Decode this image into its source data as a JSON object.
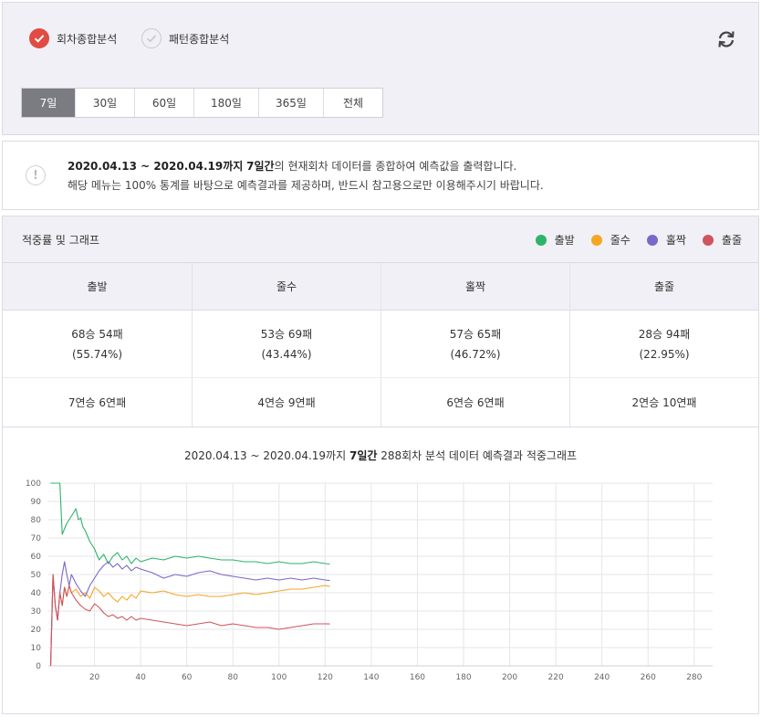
{
  "analysis_type": {
    "options": [
      {
        "label": "회차종합분석",
        "selected": true
      },
      {
        "label": "패턴종합분석",
        "selected": false
      }
    ],
    "refresh_icon": "refresh-icon"
  },
  "periods": {
    "items": [
      "7일",
      "30일",
      "60일",
      "180일",
      "365일",
      "전체"
    ],
    "active": "7일"
  },
  "notice": {
    "icon": "exclamation-icon",
    "range": "2020.04.13 ~ 2020.04.19까지",
    "days": "7일간",
    "line1_rest": "의 현재회차 데이터를 종합하여 예측값을 출력합니다.",
    "line2": "해당 메뉴는 100% 통계를 바탕으로 예측결과를 제공하며, 반드시 참고용으로만 이용해주시기 바랍니다."
  },
  "result": {
    "title": "적중률 및 그래프",
    "legend": [
      {
        "label": "출발",
        "color": "#2db36a"
      },
      {
        "label": "줄수",
        "color": "#f5a623"
      },
      {
        "label": "홀짝",
        "color": "#7b67c9"
      },
      {
        "label": "출줄",
        "color": "#d0545b"
      }
    ],
    "columns": [
      "출발",
      "줄수",
      "홀짝",
      "출줄"
    ],
    "records": [
      "68승 54패",
      "53승 69패",
      "57승 65패",
      "28승 94패"
    ],
    "rates": [
      "(55.74%)",
      "(43.44%)",
      "(46.72%)",
      "(22.95%)"
    ],
    "streaks": [
      "7연승 6연패",
      "4연승 9연패",
      "6연승 6연패",
      "2연승 10연패"
    ]
  },
  "chart_title": {
    "range": "2020.04.13 ~ 2020.04.19까지",
    "days": "7일간",
    "rest": "288회차 분석 데이터 예측결과 적중그래프"
  },
  "chart_data": {
    "type": "line",
    "xlim": [
      0,
      288
    ],
    "ylim": [
      0,
      100
    ],
    "xticks": [
      20,
      40,
      60,
      80,
      100,
      120,
      140,
      160,
      180,
      200,
      220,
      240,
      260,
      280
    ],
    "yticks": [
      0,
      10,
      20,
      30,
      40,
      50,
      60,
      70,
      80,
      90,
      100
    ],
    "grid": true,
    "series": [
      {
        "name": "출발",
        "color": "#2db36a",
        "x": [
          1,
          2,
          3,
          4,
          5,
          6,
          8,
          10,
          12,
          13,
          14,
          15,
          16,
          18,
          20,
          22,
          24,
          26,
          28,
          30,
          32,
          34,
          36,
          38,
          40,
          45,
          50,
          55,
          60,
          65,
          70,
          75,
          80,
          85,
          90,
          95,
          100,
          105,
          110,
          115,
          120,
          122
        ],
        "y": [
          100,
          100,
          100,
          100,
          100,
          72,
          78,
          82,
          86,
          80,
          81,
          76,
          74,
          68,
          64,
          58,
          61,
          56,
          60,
          62,
          58,
          60,
          56,
          59,
          57,
          59,
          58,
          60,
          59,
          60,
          59,
          58,
          58,
          57,
          57,
          56,
          57,
          56,
          56,
          57,
          56,
          55.74
        ]
      },
      {
        "name": "줄수",
        "color": "#f5a623",
        "x": [
          1,
          2,
          3,
          4,
          5,
          6,
          7,
          8,
          9,
          10,
          12,
          14,
          16,
          18,
          20,
          22,
          24,
          26,
          28,
          30,
          32,
          34,
          36,
          38,
          40,
          45,
          50,
          55,
          60,
          65,
          70,
          75,
          80,
          85,
          90,
          95,
          100,
          105,
          110,
          115,
          120,
          122
        ],
        "y": [
          0,
          50,
          33,
          25,
          40,
          33,
          43,
          38,
          44,
          40,
          42,
          38,
          40,
          37,
          43,
          41,
          38,
          40,
          37,
          35,
          38,
          36,
          39,
          37,
          41,
          40,
          41,
          39,
          38,
          39,
          38,
          38,
          39,
          40,
          39,
          40,
          41,
          42,
          42,
          43,
          44,
          43.44
        ]
      },
      {
        "name": "홀짝",
        "color": "#7b67c9",
        "x": [
          1,
          2,
          3,
          4,
          5,
          6,
          7,
          8,
          9,
          10,
          12,
          14,
          16,
          18,
          20,
          22,
          24,
          26,
          28,
          30,
          32,
          34,
          36,
          38,
          40,
          45,
          50,
          55,
          60,
          65,
          70,
          75,
          80,
          85,
          90,
          95,
          100,
          105,
          110,
          115,
          120,
          122
        ],
        "y": [
          0,
          50,
          33,
          25,
          40,
          50,
          57,
          50,
          44,
          50,
          45,
          41,
          38,
          44,
          48,
          52,
          55,
          57,
          54,
          56,
          53,
          55,
          52,
          54,
          53,
          51,
          48,
          50,
          49,
          51,
          52,
          50,
          49,
          48,
          47,
          48,
          47,
          48,
          47,
          48,
          47,
          46.72
        ]
      },
      {
        "name": "출줄",
        "color": "#d0545b",
        "x": [
          1,
          2,
          3,
          4,
          5,
          6,
          7,
          8,
          9,
          10,
          12,
          14,
          16,
          18,
          20,
          22,
          24,
          26,
          28,
          30,
          32,
          34,
          36,
          38,
          40,
          45,
          50,
          55,
          60,
          65,
          70,
          75,
          80,
          85,
          90,
          95,
          100,
          105,
          110,
          115,
          120,
          122
        ],
        "y": [
          0,
          50,
          33,
          25,
          40,
          33,
          43,
          38,
          44,
          40,
          36,
          33,
          31,
          30,
          34,
          32,
          29,
          27,
          28,
          26,
          27,
          25,
          27,
          25,
          26,
          25,
          24,
          23,
          22,
          23,
          24,
          22,
          23,
          22,
          21,
          21,
          20,
          21,
          22,
          23,
          23,
          22.95
        ]
      }
    ]
  }
}
